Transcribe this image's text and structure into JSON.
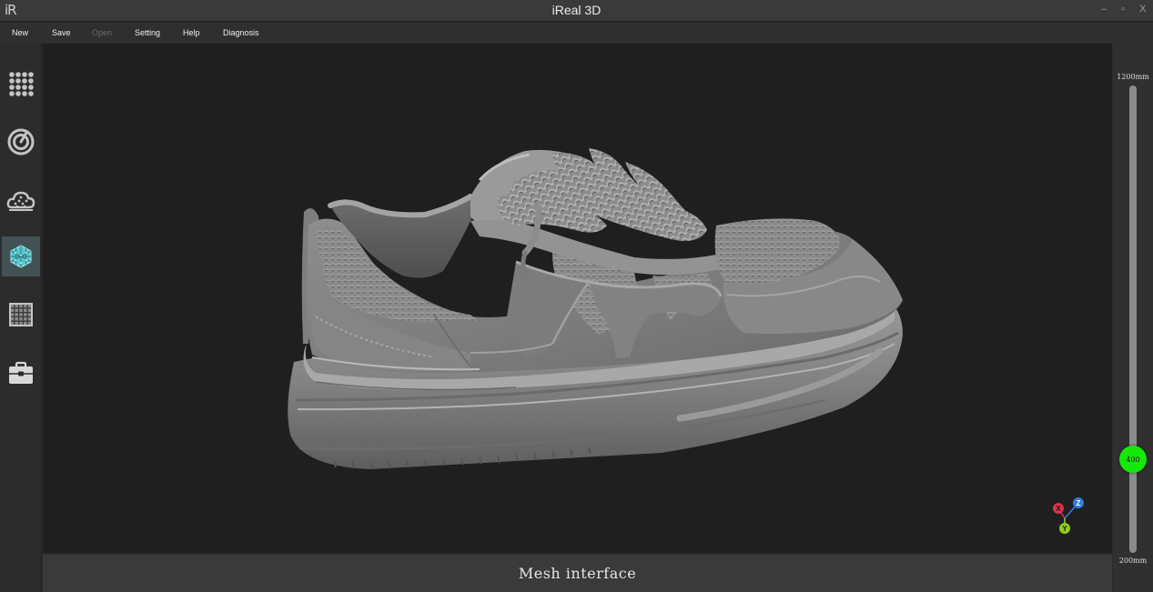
{
  "window": {
    "logo_text": "iR",
    "title": "iReal 3D",
    "controls": {
      "minimize": "–",
      "maximize": "▫",
      "close": "X"
    }
  },
  "menu": {
    "items": [
      {
        "label": "New",
        "enabled": true
      },
      {
        "label": "Save",
        "enabled": true
      },
      {
        "label": "Open",
        "enabled": false
      },
      {
        "label": "Setting",
        "enabled": true
      },
      {
        "label": "Help",
        "enabled": true
      },
      {
        "label": "Diagnosis",
        "enabled": true
      }
    ]
  },
  "toolrail": {
    "tools": [
      {
        "icon": "grid-dots-icon",
        "active": false
      },
      {
        "icon": "scan-dial-icon",
        "active": false
      },
      {
        "icon": "point-cloud-icon",
        "active": false
      },
      {
        "icon": "mesh-cube-icon",
        "active": true
      },
      {
        "icon": "texture-grid-icon",
        "active": false
      },
      {
        "icon": "toolbox-icon",
        "active": false
      }
    ]
  },
  "viewport": {
    "model": "shoe-mesh",
    "background": "#1f1f1f",
    "gizmo": {
      "x_label": "X",
      "y_label": "Y",
      "z_label": "Z",
      "x_color": "#d8344a",
      "y_color": "#8ccf1c",
      "z_color": "#2f7be0"
    }
  },
  "status": {
    "text": "Mesh interface"
  },
  "distance_slider": {
    "max_label": "1200mm",
    "min_label": "200mm",
    "min": 200,
    "max": 1200,
    "value": 400,
    "value_label": "400",
    "thumb_color": "#16e80a"
  }
}
